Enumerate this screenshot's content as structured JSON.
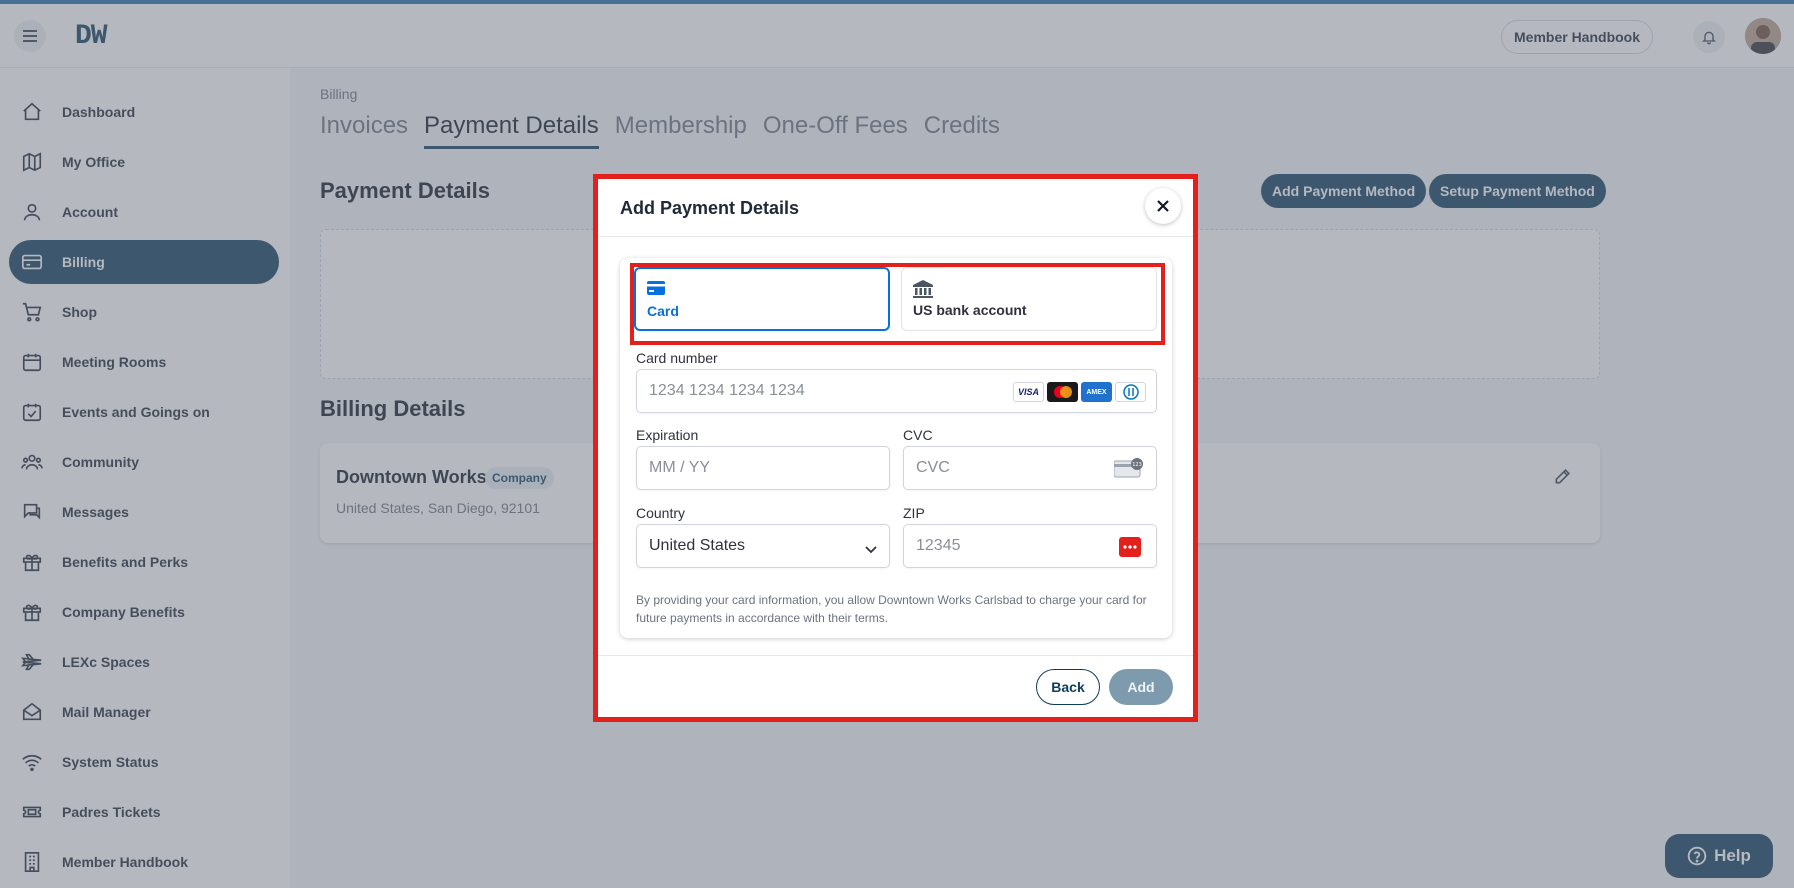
{
  "app": {
    "logo": "DW",
    "header": {
      "handbook_label": "Member Handbook"
    }
  },
  "sidebar": {
    "items": [
      {
        "label": "Dashboard",
        "icon": "home-icon"
      },
      {
        "label": "My Office",
        "icon": "map-icon"
      },
      {
        "label": "Account",
        "icon": "user-icon"
      },
      {
        "label": "Billing",
        "icon": "credit-card-icon",
        "active": true
      },
      {
        "label": "Shop",
        "icon": "cart-icon"
      },
      {
        "label": "Meeting Rooms",
        "icon": "calendar-icon"
      },
      {
        "label": "Events and Goings on",
        "icon": "calendar-check-icon"
      },
      {
        "label": "Community",
        "icon": "people-icon"
      },
      {
        "label": "Messages",
        "icon": "chat-icon"
      },
      {
        "label": "Benefits and Perks",
        "icon": "gift-icon"
      },
      {
        "label": "Company Benefits",
        "icon": "gift-icon"
      },
      {
        "label": "LEXc Spaces",
        "icon": "plane-icon"
      },
      {
        "label": "Mail Manager",
        "icon": "mail-open-icon"
      },
      {
        "label": "System Status",
        "icon": "wifi-icon"
      },
      {
        "label": "Padres Tickets",
        "icon": "ticket-icon"
      },
      {
        "label": "Member Handbook",
        "icon": "building-icon"
      }
    ]
  },
  "main": {
    "breadcrumb": "Billing",
    "tabs": [
      {
        "label": "Invoices"
      },
      {
        "label": "Payment Details",
        "active": true
      },
      {
        "label": "Membership"
      },
      {
        "label": "One-Off Fees"
      },
      {
        "label": "Credits"
      }
    ],
    "payment_section_title": "Payment Details",
    "add_payment_method": "Add Payment Method",
    "setup_payment_method": "Setup Payment Method",
    "billing_section_title": "Billing Details",
    "billing": {
      "company_name": "Downtown Works",
      "company_badge": "Company",
      "address": "United States, San Diego, 92101"
    }
  },
  "help_label": "Help",
  "modal": {
    "title": "Add Payment Details",
    "methods": [
      {
        "label": "Card",
        "icon": "card-icon",
        "selected": true
      },
      {
        "label": "US bank account",
        "icon": "bank-icon",
        "selected": false
      }
    ],
    "card_number": {
      "label": "Card number",
      "placeholder": "1234 1234 1234 1234"
    },
    "card_brands": [
      "VISA",
      "Mastercard",
      "AMEX",
      "Diners"
    ],
    "expiration": {
      "label": "Expiration",
      "placeholder": "MM / YY"
    },
    "cvc": {
      "label": "CVC",
      "placeholder": "CVC"
    },
    "country": {
      "label": "Country",
      "value": "United States"
    },
    "zip": {
      "label": "ZIP",
      "placeholder": "12345"
    },
    "disclaimer": "By providing your card information, you allow Downtown Works Carlsbad to charge your card for future payments in accordance with their terms.",
    "back_label": "Back",
    "add_label": "Add"
  },
  "colors": {
    "primary": "#0e3d5c",
    "highlight": "#e3201b",
    "stripe_blue": "#0570de",
    "overlay": "rgba(107,114,128,0.5)"
  }
}
